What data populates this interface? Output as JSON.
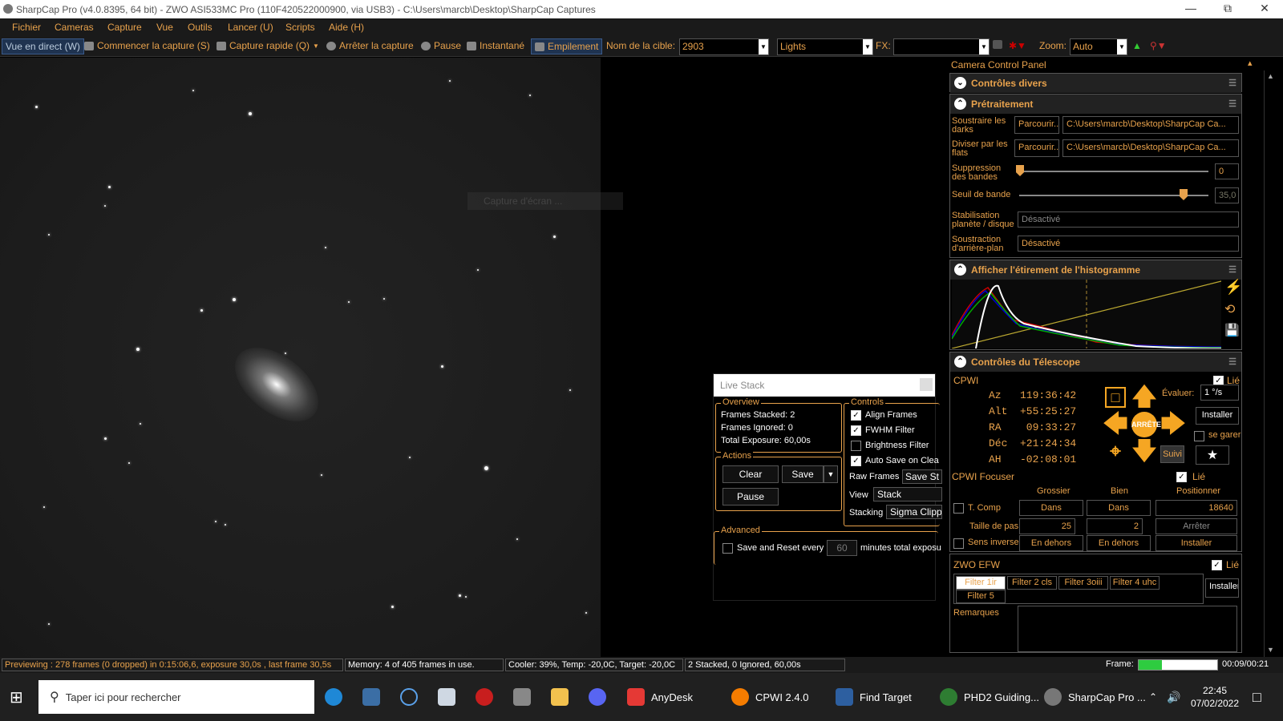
{
  "window": {
    "title": "SharpCap Pro (v4.0.8395, 64 bit) - ZWO ASI533MC Pro (110F420522000900, via USB3) - C:\\Users\\marcb\\Desktop\\SharpCap Captures"
  },
  "menu": [
    "Fichier",
    "Cameras",
    "Capture",
    "Vue",
    "Outils",
    "Lancer (U)",
    "Scripts",
    "Aide (H)"
  ],
  "toolbar": {
    "live": "Vue en direct (W)",
    "start": "Commencer la capture (S)",
    "quick": "Capture rapide (Q)",
    "stop": "Arrêter la capture",
    "pause": "Pause",
    "snapshot": "Instantané",
    "stack": "Empilement",
    "target_label": "Nom de la cible:",
    "target_value": "2903",
    "frame_type": "Lights",
    "fx_label": "FX:",
    "zoom_label": "Zoom:",
    "zoom_value": "Auto"
  },
  "ghost_text": "Capture d'écran ...",
  "live_stack": {
    "title": "Live Stack",
    "overview_label": "Overview",
    "frames_stacked": "Frames Stacked: 2",
    "frames_ignored": "Frames Ignored: 0",
    "total_exposure": "Total Exposure:  60,00s",
    "controls_label": "Controls",
    "align": "Align Frames",
    "fwhm": "FWHM Filter",
    "brightness": "Brightness Filter",
    "autosave": "Auto Save on Clea",
    "raw_frames": "Raw Frames",
    "save_st": "Save St",
    "view_label": "View",
    "view_value": "Stack",
    "stacking_label": "Stacking",
    "stacking_value": "Sigma Clipp",
    "actions_label": "Actions",
    "clear": "Clear",
    "save": "Save",
    "pause": "Pause",
    "advanced_label": "Advanced",
    "save_reset": "Save and Reset every",
    "minutes_value": "60",
    "minutes_text": "minutes total exposu"
  },
  "panel": {
    "title": "Camera Control Panel",
    "misc": "Contrôles divers",
    "preproc": "Prétraitement",
    "darks_label": "Soustraire les darks",
    "flats_label": "Diviser par les flats",
    "browse": "Parcourir...",
    "darks_path": "C:\\Users\\marcb\\Desktop\\SharpCap Ca...",
    "flats_path": "C:\\Users\\marcb\\Desktop\\SharpCap Ca...",
    "banding_label": "Suppression des bandes",
    "banding_value": "0",
    "threshold_label": "Seuil de bande",
    "threshold_value": "35,0",
    "stab_label": "Stabilisation planète / disque",
    "stab_value": "Désactivé",
    "bg_label": "Soustraction d'arrière-plan",
    "bg_value": "Désactivé",
    "histo": "Afficher l'étirement de l'histogramme",
    "telescope": "Contrôles du Télescope",
    "cpwi": "CPWI",
    "linked": "Lié",
    "az": "Az   119:36:42",
    "alt": "Alt  +55:25:27",
    "ra": "RA    09:33:27",
    "dec": "Déc  +21:24:34",
    "ah": "AH   -02:08:01",
    "stop_btn": "ARRÊTE",
    "rate_label": "Évaluer:",
    "rate_value": "1 °/s",
    "install": "Installer",
    "park": "se garer",
    "track": "Suivi",
    "focuser": "CPWI Focuser",
    "coarse": "Grossier",
    "fine": "Bien",
    "position": "Positionner",
    "tcomp": "T. Comp",
    "in": "Dans",
    "pos_value": "18640",
    "step_label": "Taille de pas",
    "step_coarse": "25",
    "step_fine": "2",
    "stop": "Arrêter",
    "reverse": "Sens inverse",
    "out": "En dehors",
    "efw": "ZWO EFW",
    "filters": [
      "Filter 1ir",
      "Filter 2 cls",
      "Filter 3oiii",
      "Filter 4 uhc",
      "Filter 5"
    ],
    "notes": "Remarques",
    "frame_label": "Frame:",
    "frame_time": "00:09/00:21"
  },
  "status": {
    "preview": "Previewing : 278 frames (0 dropped) in 0:15:06,6, exposure 30,0s , last frame 30,5s",
    "memory": "Memory: 4 of 405 frames in use.",
    "cooler": "Cooler: 39%, Temp: -20,0C, Target: -20,0C",
    "stacked": "2 Stacked, 0 Ignored, 60,00s"
  },
  "taskbar": {
    "search": "Taper ici pour rechercher",
    "anydesk": "AnyDesk",
    "cpwi": "CPWI 2.4.0",
    "find": "Find Target",
    "phd": "PHD2 Guiding...",
    "sharpcap": "SharpCap Pro ...",
    "time": "22:45",
    "date": "07/02/2022"
  },
  "colors": {
    "accent": "#e8a24c",
    "panel_bg": "#000000",
    "frame_progress": "#2ecc40"
  }
}
